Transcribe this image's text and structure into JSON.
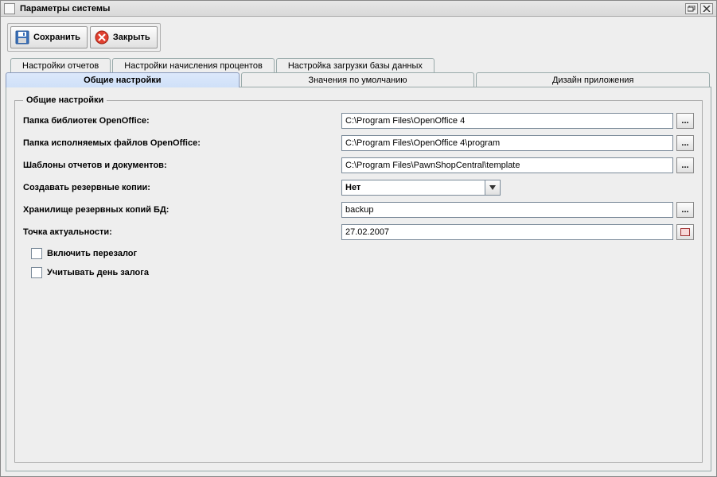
{
  "window": {
    "title": "Параметры системы"
  },
  "toolbar": {
    "save_label": "Сохранить",
    "close_label": "Закрыть"
  },
  "tabs_row1": [
    {
      "label": "Настройки отчетов"
    },
    {
      "label": "Настройки начисления процентов"
    },
    {
      "label": "Настройка загрузки базы данных"
    }
  ],
  "tabs_row2": [
    {
      "label": "Общие настройки",
      "active": true
    },
    {
      "label": "Значения по умолчанию"
    },
    {
      "label": "Дизайн приложения"
    }
  ],
  "fieldset": {
    "legend": "Общие настройки"
  },
  "form": {
    "oo_lib_label": "Папка библиотек OpenOffice:",
    "oo_lib_value": "C:\\Program Files\\OpenOffice 4",
    "oo_exe_label": "Папка исполняемых файлов OpenOffice:",
    "oo_exe_value": "C:\\Program Files\\OpenOffice 4\\program",
    "templates_label": "Шаблоны отчетов и документов:",
    "templates_value": "C:\\Program Files\\PawnShopCentral\\template",
    "backup_create_label": "Создавать резервные копии:",
    "backup_create_value": "Нет",
    "backup_store_label": "Хранилище резервных копий БД:",
    "backup_store_value": "backup",
    "actual_point_label": "Точка актуальности:",
    "actual_point_value": "27.02.2007",
    "enable_repledge_label": "Включить перезалог",
    "count_pledge_day_label": "Учитывать день залога",
    "browse_btn": "..."
  }
}
